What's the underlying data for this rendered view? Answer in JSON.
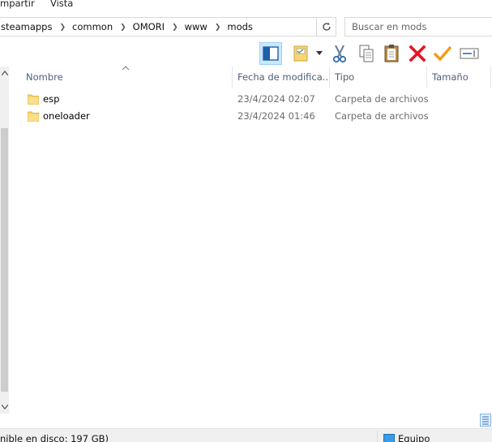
{
  "ribbon": {
    "tabs": [
      "mpartir",
      "Vista"
    ]
  },
  "address": {
    "crumbs": [
      "steamapps",
      "common",
      "OMORI",
      "www",
      "mods"
    ],
    "separator": "❯"
  },
  "search": {
    "placeholder": "Buscar en mods"
  },
  "toolbar": {
    "buttons": [
      "preview-pane",
      "properties",
      "cut",
      "copy",
      "paste",
      "delete",
      "check",
      "rename"
    ]
  },
  "columns": {
    "name": "Nombre",
    "date": "Fecha de modifica...",
    "type": "Tipo",
    "size": "Tamaño"
  },
  "files": [
    {
      "name": "esp",
      "date": "23/4/2024 02:07",
      "type": "Carpeta de archivos"
    },
    {
      "name": "oneloader",
      "date": "23/4/2024 01:46",
      "type": "Carpeta de archivos"
    }
  ],
  "status": {
    "free_space": "nible en disco: 197 GB)",
    "location": "Equipo"
  },
  "colors": {
    "header_text": "#4c607a",
    "meta_text": "#6d6d6d",
    "folder": "#f7d674",
    "delete": "#e81123",
    "check": "#f39c12",
    "selected_bg": "#cce8ff"
  }
}
